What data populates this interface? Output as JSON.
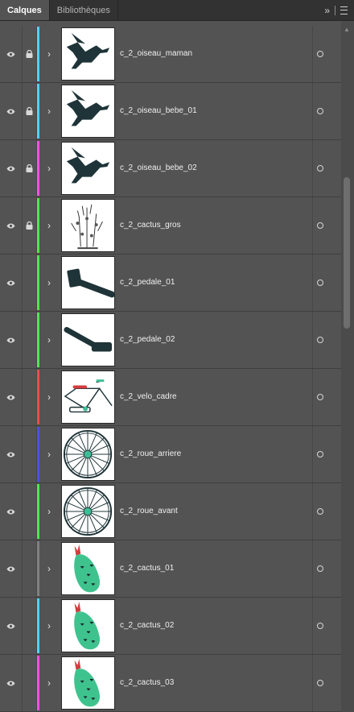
{
  "tabs": [
    {
      "label": "Calques",
      "active": true
    },
    {
      "label": "Bibliothèques",
      "active": false
    }
  ],
  "controls": {
    "collapse_icon": "double-chevron-right-icon",
    "menu_icon": "panel-menu-icon"
  },
  "layers": [
    {
      "name": "c_2_oiseau_maman",
      "visible": true,
      "locked": true,
      "color": "#4fd2ff",
      "thumb": "bird-icon"
    },
    {
      "name": "c_2_oiseau_bebe_01",
      "visible": true,
      "locked": true,
      "color": "#4fd2ff",
      "thumb": "bird-icon"
    },
    {
      "name": "c_2_oiseau_bebe_02",
      "visible": true,
      "locked": true,
      "color": "#ff4fe1",
      "thumb": "bird-icon"
    },
    {
      "name": "c_2_cactus_gros",
      "visible": true,
      "locked": true,
      "color": "#4fe64f",
      "thumb": "cactus-sketch-icon"
    },
    {
      "name": "c_2_pedale_01",
      "visible": true,
      "locked": false,
      "color": "#4fe64f",
      "thumb": "pedal-icon"
    },
    {
      "name": "c_2_pedale_02",
      "visible": true,
      "locked": false,
      "color": "#4fe64f",
      "thumb": "pedal-tilted-icon"
    },
    {
      "name": "c_2_velo_cadre",
      "visible": true,
      "locked": false,
      "color": "#e84f4f",
      "thumb": "bike-frame-icon"
    },
    {
      "name": "c_2_roue_arriere",
      "visible": true,
      "locked": false,
      "color": "#4f4fe6",
      "thumb": "wheel-icon"
    },
    {
      "name": "c_2_roue_avant",
      "visible": true,
      "locked": false,
      "color": "#4fe64f",
      "thumb": "wheel-icon"
    },
    {
      "name": "c_2_cactus_01",
      "visible": true,
      "locked": false,
      "color": "#808080",
      "thumb": "cactus-flower-icon"
    },
    {
      "name": "c_2_cactus_02",
      "visible": true,
      "locked": false,
      "color": "#4fd2ff",
      "thumb": "cactus-flower-icon"
    },
    {
      "name": "c_2_cactus_03",
      "visible": true,
      "locked": false,
      "color": "#ff4fe1",
      "thumb": "cactus-flower-icon"
    }
  ]
}
